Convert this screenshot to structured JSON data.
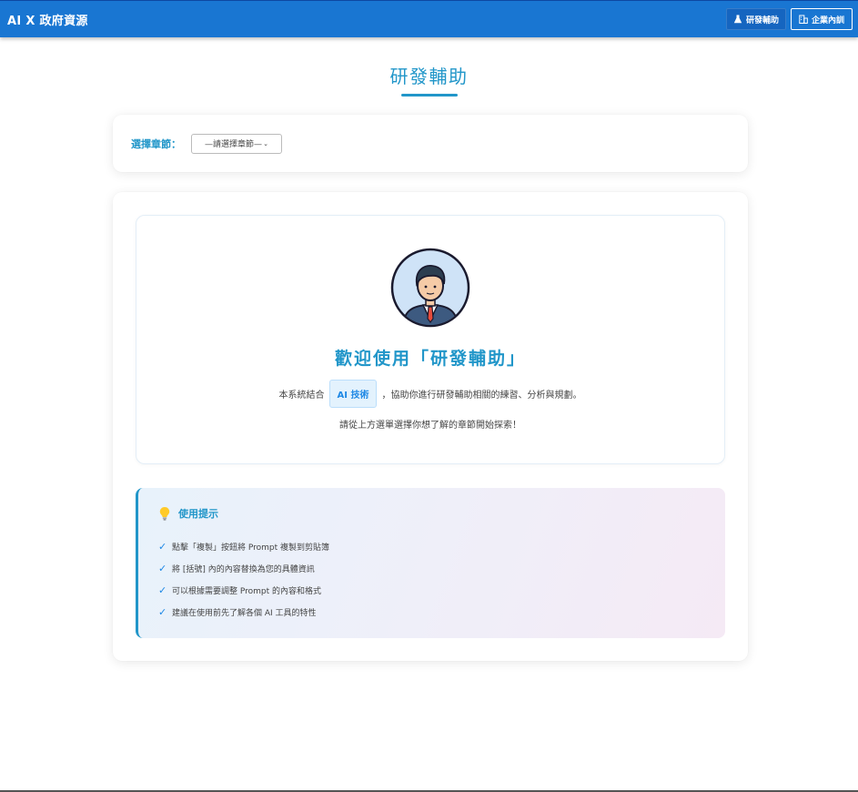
{
  "header": {
    "brand": "AI X 政府資源",
    "nav": [
      {
        "label": "研發輔助",
        "icon": "flask-icon",
        "active": true
      },
      {
        "label": "企業內訓",
        "icon": "building-icon",
        "active": false
      }
    ]
  },
  "page": {
    "title": "研發輔助"
  },
  "selector": {
    "label": "選擇章節：",
    "value": "—請選擇章節—"
  },
  "welcome": {
    "title": "歡迎使用「研發輔助」",
    "desc_before": "本系統結合",
    "badge": "AI 技術",
    "desc_after": "，協助你進行研發輔助相關的練習、分析與規劃。",
    "explore": "請從上方選單選擇你想了解的章節開始探索！",
    "avatar": "businessman-avatar-icon"
  },
  "tips": {
    "title": "使用提示",
    "icon": "lightbulb-icon",
    "items": [
      "點擊「複製」按鈕將 Prompt 複製到剪貼簿",
      "將 [括號] 內的內容替換為您的具體資訊",
      "可以根據需要調整 Prompt 的內容和格式",
      "建議在使用前先了解各個 AI 工具的特性"
    ]
  },
  "colors": {
    "header": "#1976d2",
    "accent": "#2196c9"
  }
}
